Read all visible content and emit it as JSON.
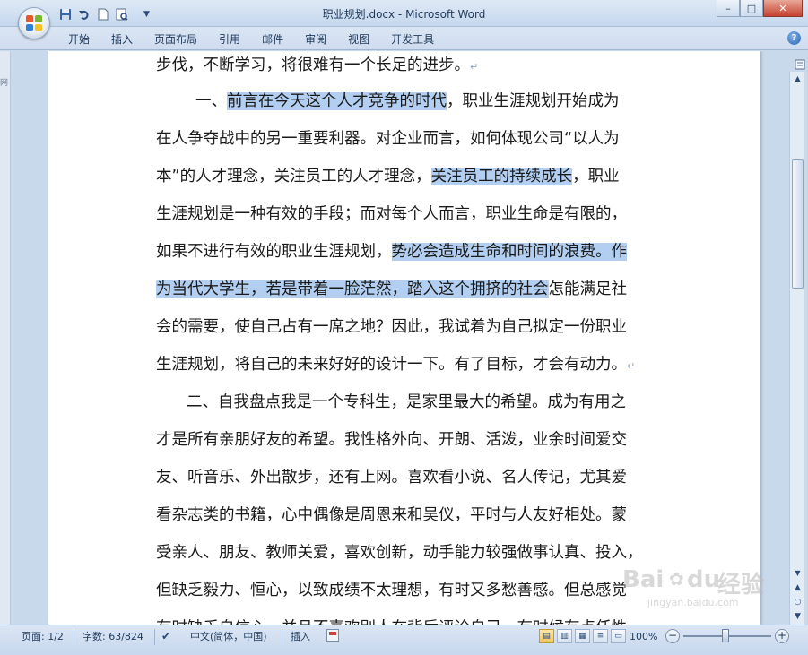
{
  "window": {
    "title": "职业规划.docx - Microsoft Word",
    "controls": {
      "minimize": "–",
      "maximize": "□",
      "close": "✕"
    }
  },
  "ribbon": {
    "tabs": [
      "开始",
      "插入",
      "页面布局",
      "引用",
      "邮件",
      "审阅",
      "视图",
      "开发工具"
    ],
    "help": "?"
  },
  "left_margin_labels": [
    "网"
  ],
  "document": {
    "lines": [
      {
        "segments": [
          {
            "text": "步伐，不断学习，将很难有一个长足的进步。",
            "hl": false
          }
        ],
        "mark": "↵"
      },
      {
        "segments": [
          {
            "text": "一、",
            "hl": false
          },
          {
            "text": "前言在今天这个人才竞争的时代",
            "hl": true
          },
          {
            "text": "，职业生涯规划开始成为",
            "hl": false
          }
        ]
      },
      {
        "segments": [
          {
            "text": "在人争夺战中的另一重要利器。对企业而言，如何体现公司“以人为",
            "hl": false
          }
        ]
      },
      {
        "segments": [
          {
            "text": "本”的人才理念，关注员工的人才理念，",
            "hl": false
          },
          {
            "text": "关注员工的持续成长",
            "hl": true
          },
          {
            "text": "，职业",
            "hl": false
          }
        ]
      },
      {
        "segments": [
          {
            "text": "生涯规划是一种有效的手段；而对每个人而言，职业生命是有限的，",
            "hl": false
          }
        ]
      },
      {
        "segments": [
          {
            "text": "如果不进行有效的职业生涯规划，",
            "hl": false
          },
          {
            "text": "势必会造成生命和时间的浪费。作",
            "hl": true
          }
        ]
      },
      {
        "segments": [
          {
            "text": "为当代大学生，若是带着一脸茫然，踏入这个拥挤的社会",
            "hl": true
          },
          {
            "text": "怎能满足社",
            "hl": false
          }
        ]
      },
      {
        "segments": [
          {
            "text": "会的需要，使自己占有一席之地？因此，我试着为自己拟定一份职业",
            "hl": false
          }
        ]
      },
      {
        "segments": [
          {
            "text": "生涯规划，将自己的未来好好的设计一下。有了目标，才会有动力。",
            "hl": false
          }
        ],
        "mark": "↵"
      },
      {
        "segments": [
          {
            "text": "二、自我盘点我是一个专科生，是家里最大的希望。成为有用之",
            "hl": false
          }
        ]
      },
      {
        "segments": [
          {
            "text": "才是所有亲朋好友的希望。我性格外向、开朗、活泼，业余时间爱交",
            "hl": false
          }
        ]
      },
      {
        "segments": [
          {
            "text": "友、听音乐、外出散步，还有上网。喜欢看小说、名人传记，尤其爱",
            "hl": false
          }
        ]
      },
      {
        "segments": [
          {
            "text": "看杂志类的书籍，心中偶像是周恩来和吴仪，平时与人友好相处。蒙",
            "hl": false
          }
        ]
      },
      {
        "segments": [
          {
            "text": "受亲人、朋友、教师关爱，喜欢创新，动手能力较强做事认真、投入，",
            "hl": false
          }
        ]
      },
      {
        "segments": [
          {
            "text": "但缺乏毅力、恒心，以致成绩不太理想，有时又多愁善感。但总感觉",
            "hl": false
          }
        ]
      },
      {
        "segments": [
          {
            "text": "有时缺乏自信心，并且不喜欢别人在背后评论自己。有时候有点任性",
            "hl": false
          }
        ]
      }
    ]
  },
  "statusbar": {
    "page": "页面: 1/2",
    "words": "字数: 63/824",
    "language": "中文(简体，中国)",
    "insert_mode": "插入",
    "zoom": "100%"
  },
  "watermark": {
    "brand": "Bai",
    "brand2": "du",
    "suffix": "经验",
    "url": "jingyan.baidu.com"
  },
  "colors": {
    "highlight": "#b2cff2",
    "chrome": "#c9d9ec"
  }
}
